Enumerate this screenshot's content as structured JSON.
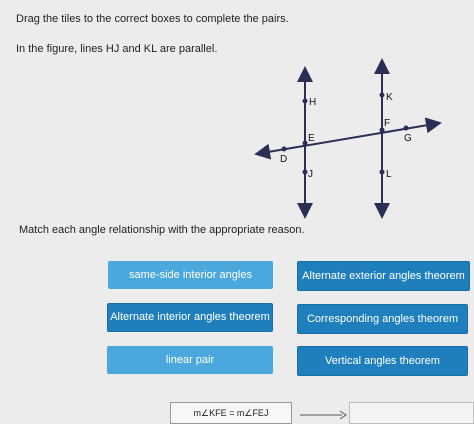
{
  "instruction": "Drag the tiles to the correct boxes to complete the pairs.",
  "prompt": "In the figure, lines HJ and KL are parallel.",
  "match_text": "Match each angle relationship with the appropriate reason.",
  "figure": {
    "points": {
      "H": "H",
      "K": "K",
      "E": "E",
      "F": "F",
      "G": "G",
      "D": "D",
      "J": "J",
      "L": "L"
    }
  },
  "tiles": [
    {
      "label": "same-side interior angles"
    },
    {
      "label": "Alternate exterior angles theorem"
    },
    {
      "label": "Alternate interior angles theorem"
    },
    {
      "label": "Corresponding angles theorem"
    },
    {
      "label": "linear pair"
    },
    {
      "label": "Vertical angles theorem"
    }
  ],
  "pair": {
    "left": "m∠KFE = m∠FEJ",
    "right": ""
  },
  "colors": {
    "tile_light": "#4aa8dc",
    "tile_dark": "#1f7fbd",
    "line": "#2b2f55"
  }
}
